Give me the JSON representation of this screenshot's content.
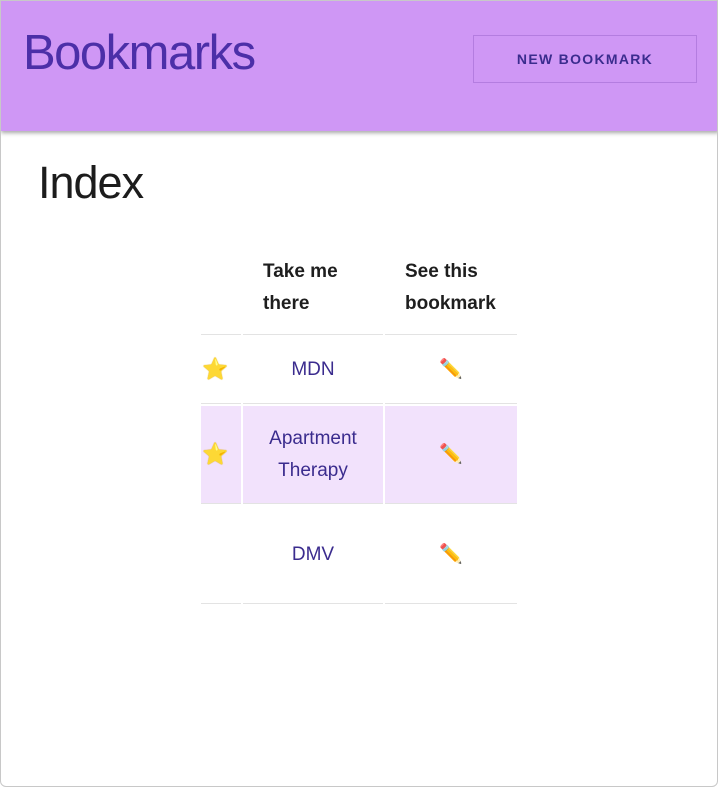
{
  "header": {
    "title": "Bookmarks",
    "new_button_label": "NEW BOOKMARK"
  },
  "page": {
    "title": "Index"
  },
  "table": {
    "columns": [
      "",
      "Take me there",
      "See this bookmark"
    ],
    "rows": [
      {
        "starred": true,
        "star_icon": "⭐",
        "link": "MDN",
        "edit_icon": "✏️"
      },
      {
        "starred": true,
        "star_icon": "⭐",
        "link": "Apartment Therapy",
        "edit_icon": "✏️"
      },
      {
        "starred": false,
        "star_icon": "",
        "link": "DMV",
        "edit_icon": "✏️"
      }
    ]
  },
  "colors": {
    "header_bg": "#cf97f5",
    "brand": "#4c2fa8",
    "link": "#3b2c8e",
    "highlight_row": "#f2e2fc"
  },
  "icons": {
    "star": "star-icon",
    "edit": "pencil-icon"
  }
}
